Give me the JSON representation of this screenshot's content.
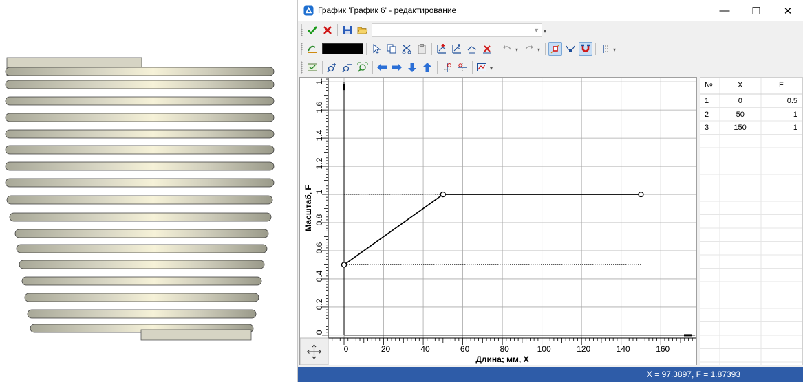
{
  "window": {
    "title": "График 'График 6' - редактирование",
    "minimize": "—",
    "maximize": "☐",
    "close": "✕"
  },
  "toolbar1": {
    "combo_value": ""
  },
  "toolbar2": {
    "line_color": "#000000"
  },
  "chart_data": {
    "type": "line",
    "xlabel": "Длина; мм, X",
    "ylabel": "Масштаб, F",
    "xlim": [
      -8,
      178
    ],
    "ylim": [
      -0.02,
      1.83
    ],
    "x_ticks": [
      0,
      20,
      40,
      60,
      80,
      100,
      120,
      140,
      160
    ],
    "y_ticks": [
      0,
      0.2,
      0.4,
      0.6,
      0.8,
      1,
      1.2,
      1.4,
      1.6,
      1.8
    ],
    "x_tick_labels": [
      "0",
      "20",
      "40",
      "60",
      "80",
      "100",
      "120",
      "140",
      "160"
    ],
    "y_tick_labels": [
      "0",
      "0.2",
      "0.4",
      "0.6",
      "0.8",
      "1",
      "1.2",
      "1.4",
      "1.6",
      "1.8"
    ],
    "series": [
      {
        "x": [
          0,
          50,
          150
        ],
        "y": [
          0.5,
          1,
          1
        ]
      }
    ],
    "grid": true
  },
  "table": {
    "headers": [
      "№",
      "X",
      "F"
    ],
    "rows": [
      [
        "1",
        "0",
        "0.5"
      ],
      [
        "2",
        "50",
        "1"
      ],
      [
        "3",
        "150",
        "1"
      ]
    ]
  },
  "status": {
    "text": "X = 97.3897, F = 1.87393"
  }
}
